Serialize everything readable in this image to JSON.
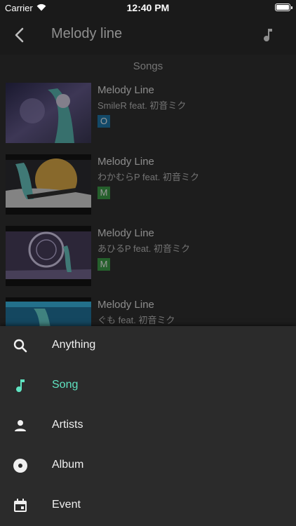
{
  "status_bar": {
    "carrier": "Carrier",
    "time": "12:40 PM"
  },
  "app_bar": {
    "title": "Melody line"
  },
  "section_header": "Songs",
  "songs": [
    {
      "title": "Melody Line",
      "artist": "SmileR feat. 初音ミク",
      "badge": "O",
      "badge_color": "#0d6fa8"
    },
    {
      "title": "Melody Line",
      "artist": "わかむらP feat. 初音ミク",
      "badge": "M",
      "badge_color": "#2e9a3a"
    },
    {
      "title": "Melody Line",
      "artist": "あひるP feat. 初音ミク",
      "badge": "M",
      "badge_color": "#2e9a3a"
    },
    {
      "title": "Melody Line",
      "artist": "ぐも feat. 初音ミク",
      "badge": "",
      "badge_color": "#2e9a3a"
    }
  ],
  "search_options": [
    {
      "label": "Anything",
      "icon": "search-icon",
      "active": false
    },
    {
      "label": "Song",
      "icon": "music-note-icon",
      "active": true
    },
    {
      "label": "Artists",
      "icon": "person-icon",
      "active": false
    },
    {
      "label": "Album",
      "icon": "album-icon",
      "active": false
    },
    {
      "label": "Event",
      "icon": "calendar-icon",
      "active": false
    }
  ],
  "colors": {
    "accent": "#5fe3c1",
    "sheet_background": "#2b2b2b"
  }
}
